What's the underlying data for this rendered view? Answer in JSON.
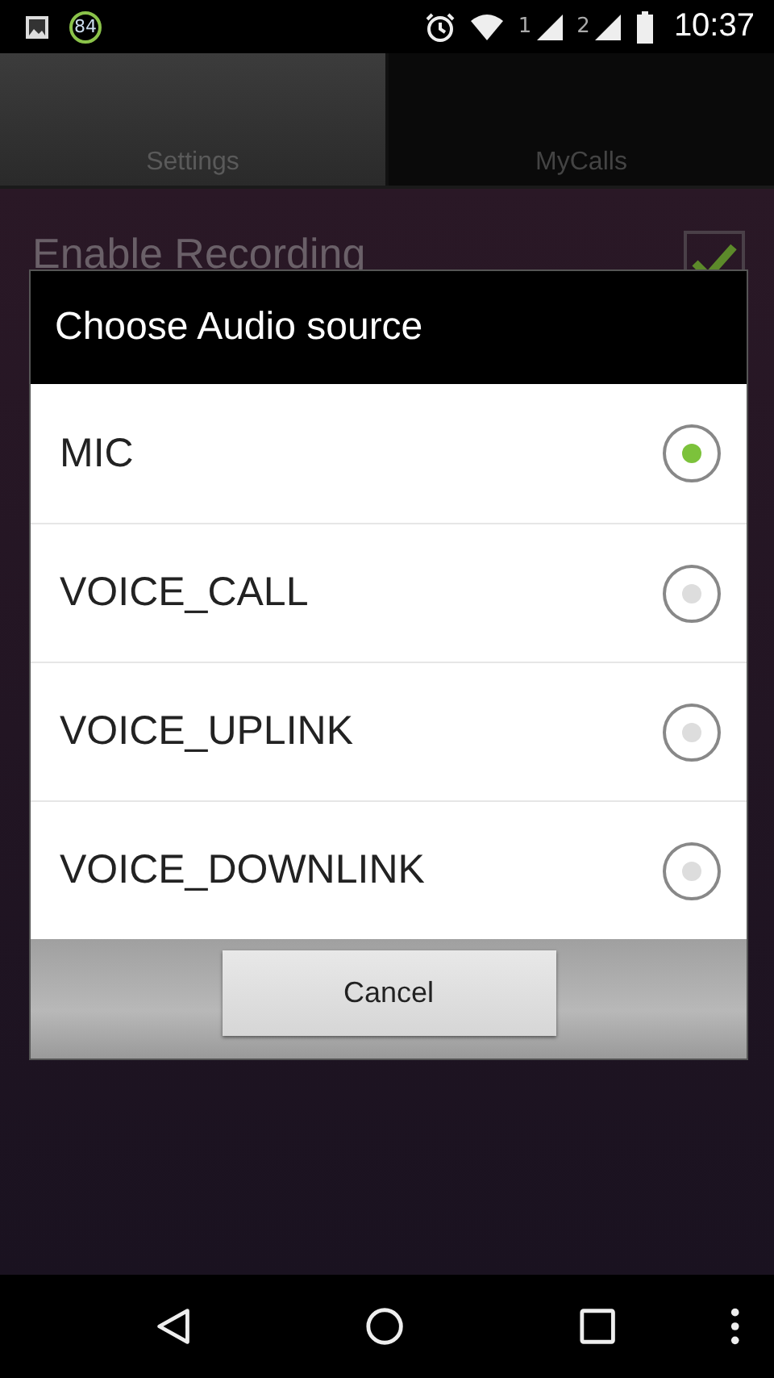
{
  "status_bar": {
    "notification_count": "84",
    "sim_1": "1",
    "sim_2": "2",
    "time": "10:37"
  },
  "tabs": [
    {
      "label": "Settings",
      "selected": true
    },
    {
      "label": "MyCalls",
      "selected": false
    }
  ],
  "settings": [
    {
      "title": "Enable Recording",
      "checked": true
    }
  ],
  "dialog": {
    "title": "Choose Audio source",
    "options": [
      {
        "label": "MIC",
        "selected": true
      },
      {
        "label": "VOICE_CALL",
        "selected": false
      },
      {
        "label": "VOICE_UPLINK",
        "selected": false
      },
      {
        "label": "VOICE_DOWNLINK",
        "selected": false
      }
    ],
    "buttons": [
      "Cancel"
    ]
  }
}
